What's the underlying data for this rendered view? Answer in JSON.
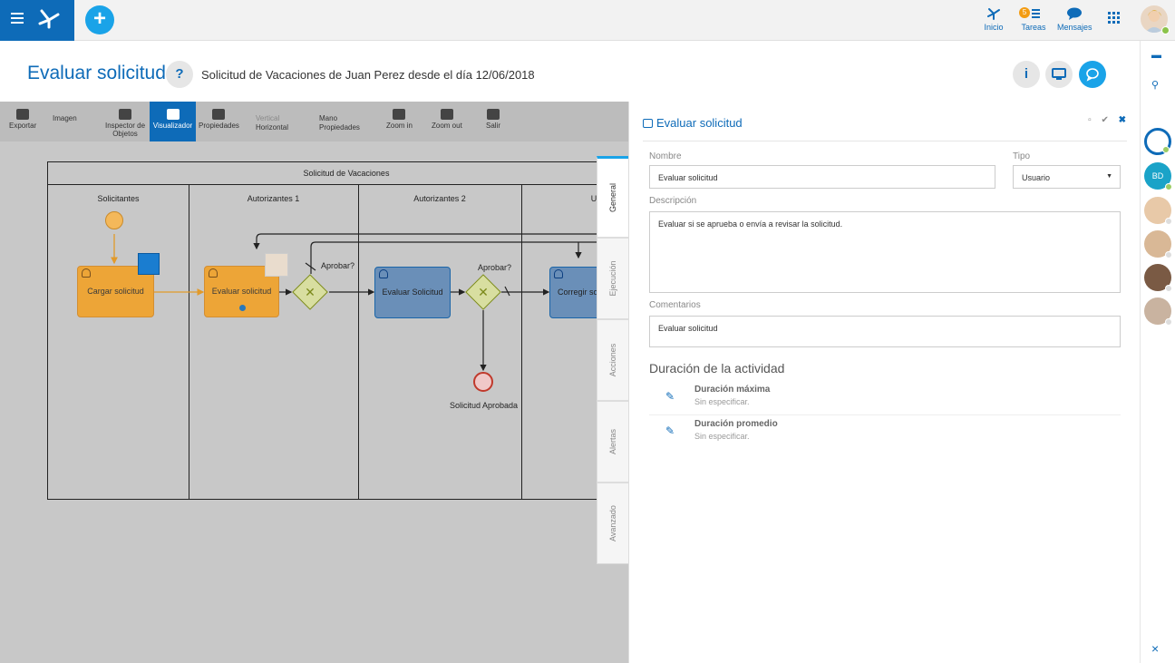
{
  "topbar": {
    "nav": [
      {
        "label": "Inicio"
      },
      {
        "label": "Tareas",
        "badge": "5"
      },
      {
        "label": "Mensajes"
      }
    ]
  },
  "header": {
    "title": "Evaluar solicitud",
    "help": "?",
    "subtitle": "Solicitud de Vacaciones de Juan  Perez desde el día 12/06/2018",
    "info": "i"
  },
  "toolbar": {
    "items": [
      {
        "label": "Exportar"
      },
      {
        "label": "Imagen"
      },
      {
        "label": "Inspector de Objetos"
      },
      {
        "label": "Visualizador"
      },
      {
        "label": "Propiedades"
      },
      {
        "label": "Vertical"
      },
      {
        "label": "Horizontal"
      },
      {
        "label": "Mano"
      },
      {
        "label": "Propiedades"
      },
      {
        "label": "Zoom in"
      },
      {
        "label": "Zoom out"
      },
      {
        "label": "Salir"
      }
    ]
  },
  "diagram": {
    "pool_title": "Solicitud de Vacaciones",
    "lanes": [
      "Solicitantes",
      "Autorizantes 1",
      "Autorizantes 2",
      "U"
    ],
    "tasks": [
      "Cargar solicitud",
      "Evaluar solicitud",
      "Evaluar Solicitud",
      "Corregir so"
    ],
    "gateway_labels": [
      "Aprobar?",
      "Aprobar?"
    ],
    "end_event": "Solicitud Aprobada"
  },
  "tabs": [
    "General",
    "Ejecución",
    "Acciones",
    "Alertas",
    "Avanzado"
  ],
  "props": {
    "title": "Evaluar solicitud",
    "nombre_label": "Nombre",
    "nombre_value": "Evaluar solicitud",
    "tipo_label": "Tipo",
    "tipo_value": "Usuario",
    "descripcion_label": "Descripción",
    "descripcion_value": "Evaluar si se aprueba o envía a revisar la solicitud.",
    "comentarios_label": "Comentarios",
    "comentarios_value": "Evaluar solicitud",
    "duracion_title": "Duración de la actividad",
    "duraciones": [
      {
        "title": "Duración máxima",
        "value": "Sin especificar."
      },
      {
        "title": "Duración promedio",
        "value": "Sin especificar."
      }
    ]
  },
  "rail": {
    "bd_initials": "BD"
  },
  "colors": {
    "brand": "#0e6bb8",
    "accent": "#1aa3e8"
  }
}
